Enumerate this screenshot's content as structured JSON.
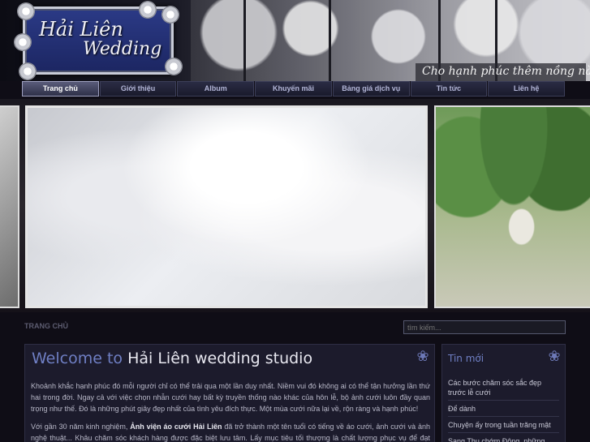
{
  "header": {
    "logo_line1": "Hải Liên",
    "logo_line2": "Wedding",
    "slogan": "Cho hạnh phúc thêm nồng nàn"
  },
  "nav": {
    "items": [
      {
        "label": "Trang chủ",
        "active": true
      },
      {
        "label": "Giới thiệu"
      },
      {
        "label": "Album"
      },
      {
        "label": "Khuyến mãi"
      },
      {
        "label": "Bảng giá dịch vụ"
      },
      {
        "label": "Tin tức"
      },
      {
        "label": "Liên hệ"
      }
    ]
  },
  "breadcrumb": "TRANG CHỦ",
  "search": {
    "placeholder": "tìm kiếm...",
    "value": "tìm kiếm..."
  },
  "main": {
    "title_prefix": "Welcome to",
    "title_name": "Hải Liên wedding studio",
    "paragraph1": "Khoảnh khắc hạnh phúc đó mỗi người chỉ có thể trải qua một lần duy nhất. Niềm vui đó không ai có thể tận hưởng lần thứ hai trong đời. Ngay cả với việc chọn nhẫn cưới hay bất kỳ truyền thống nào khác của hôn lễ, bộ ảnh cưới luôn đầy quan trọng như thế. Đó là những phút giây đẹp nhất của tình yêu đích thực. Một mùa cưới nữa lại về, rộn ràng và hạnh phúc!",
    "paragraph2_start": "Với gần 30 năm kinh nghiệm, ",
    "paragraph2_bold": "Ảnh viện áo cưới Hải Liên",
    "paragraph2_rest": " đã trở thành một tên tuổi có tiếng về áo cưới, ảnh cưới và ảnh nghệ thuật... Khâu chăm sóc khách hàng được đặc biệt lưu tâm. Lấy mục tiêu tối thượng là chất lượng phục vụ để đạt được sự hài"
  },
  "sidebar": {
    "title": "Tin mới",
    "news": [
      "Các bước chăm sóc sắc đẹp trước lễ cưới",
      "Để dành",
      "Chuyện ấy trong tuần trăng mật",
      "Sang Thu chớm Đông, những"
    ]
  },
  "icons": {
    "main_flower": "flower-icon",
    "sidebar_flower": "flower-icon"
  },
  "colors": {
    "accent": "#6f7fc4",
    "nav_active": "#5a5c7a",
    "background": "#0f0d16"
  }
}
